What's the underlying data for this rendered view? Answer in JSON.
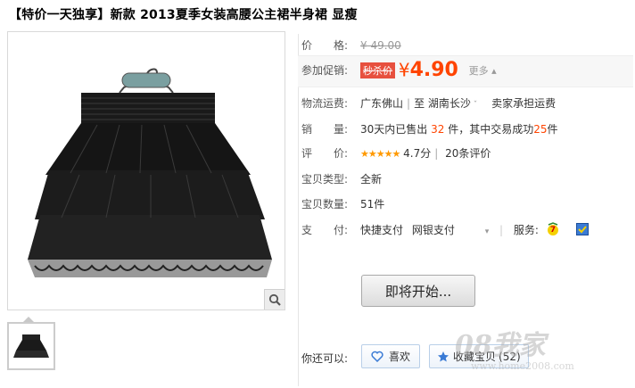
{
  "title": "【特价一天独享】新款 2013夏季女装高腰公主裙半身裙 显瘦",
  "price": {
    "label": "价　　格:",
    "original": "¥ 49.00"
  },
  "promo": {
    "label": "参加促销:",
    "badge": "秒杀价",
    "currency": "¥",
    "value": "4.90",
    "more": "更多"
  },
  "shipping": {
    "label": "物流运费:",
    "from": "广东佛山",
    "sep": "至",
    "to": "湖南长沙",
    "fee": "卖家承担运费"
  },
  "sales": {
    "label": "销　　量:",
    "prefix": "30天内已售出",
    "sold": "32",
    "mid": "件，其中交易成功",
    "success": "25",
    "suffix": "件"
  },
  "rating": {
    "label": "评　　价:",
    "stars": "★★★★★",
    "score": "4.7分",
    "count": "20条评价"
  },
  "type": {
    "label": "宝贝类型:",
    "value": "全新"
  },
  "stock": {
    "label": "宝贝数量:",
    "value": "51件"
  },
  "payment": {
    "label": "支　　付:",
    "methods": [
      "快捷支付",
      "网银支付"
    ],
    "service_label": "服务:"
  },
  "start_button": "即将开始...",
  "actions": {
    "label": "你还可以:",
    "like": "喜欢",
    "collect": "收藏宝贝",
    "collect_count": "(52)"
  },
  "watermark": {
    "brand": "08我家",
    "url": "www.home2008.com"
  },
  "icons": {
    "zoom": "magnifier-icon",
    "like": "heart-icon",
    "collect": "star-icon",
    "service1": "seven-day-return-icon",
    "service2": "guarantee-icon",
    "dropdown": "chevron-down-icon"
  },
  "colors": {
    "price": "#ff4400",
    "badge": "#e7503e",
    "star": "#ff9900"
  }
}
